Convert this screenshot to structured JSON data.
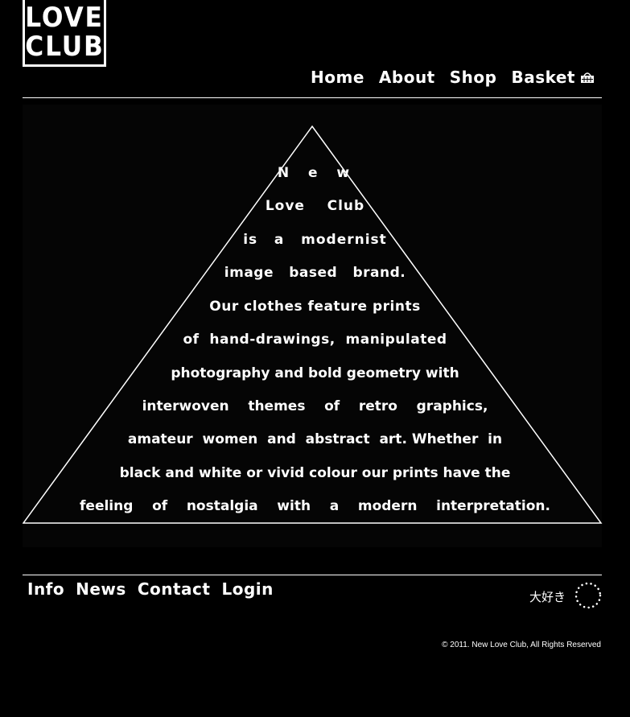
{
  "logo": {
    "line1": "LOVE",
    "line2": "CLUB"
  },
  "nav": {
    "home": "Home",
    "about": "About",
    "shop": "Shop",
    "basket": "Basket"
  },
  "pyramid_lines": [
    "N  e  w",
    "Love    Club",
    "is   a   modernist",
    "image   based   brand.",
    "Our clothes feature prints",
    "of  hand-drawings,  manipulated",
    "photography and bold geometry with",
    "interwoven    themes    of    retro    graphics,",
    "amateur  women  and  abstract  art. Whether  in",
    "black and white or vivid colour our prints have the",
    "feeling    of    nostalgia    with    a    modern    interpretation."
  ],
  "footer": {
    "info": "Info",
    "news": "News",
    "contact": "Contact",
    "login": "Login",
    "daisuki": "大好き",
    "copyright": "© 2011. New Love Club, All Rights Reserved"
  },
  "icons": {
    "basket": "basket-icon",
    "circle": "dotted-circle-icon"
  },
  "colors": {
    "background": "#000000",
    "text": "#ffffff"
  }
}
